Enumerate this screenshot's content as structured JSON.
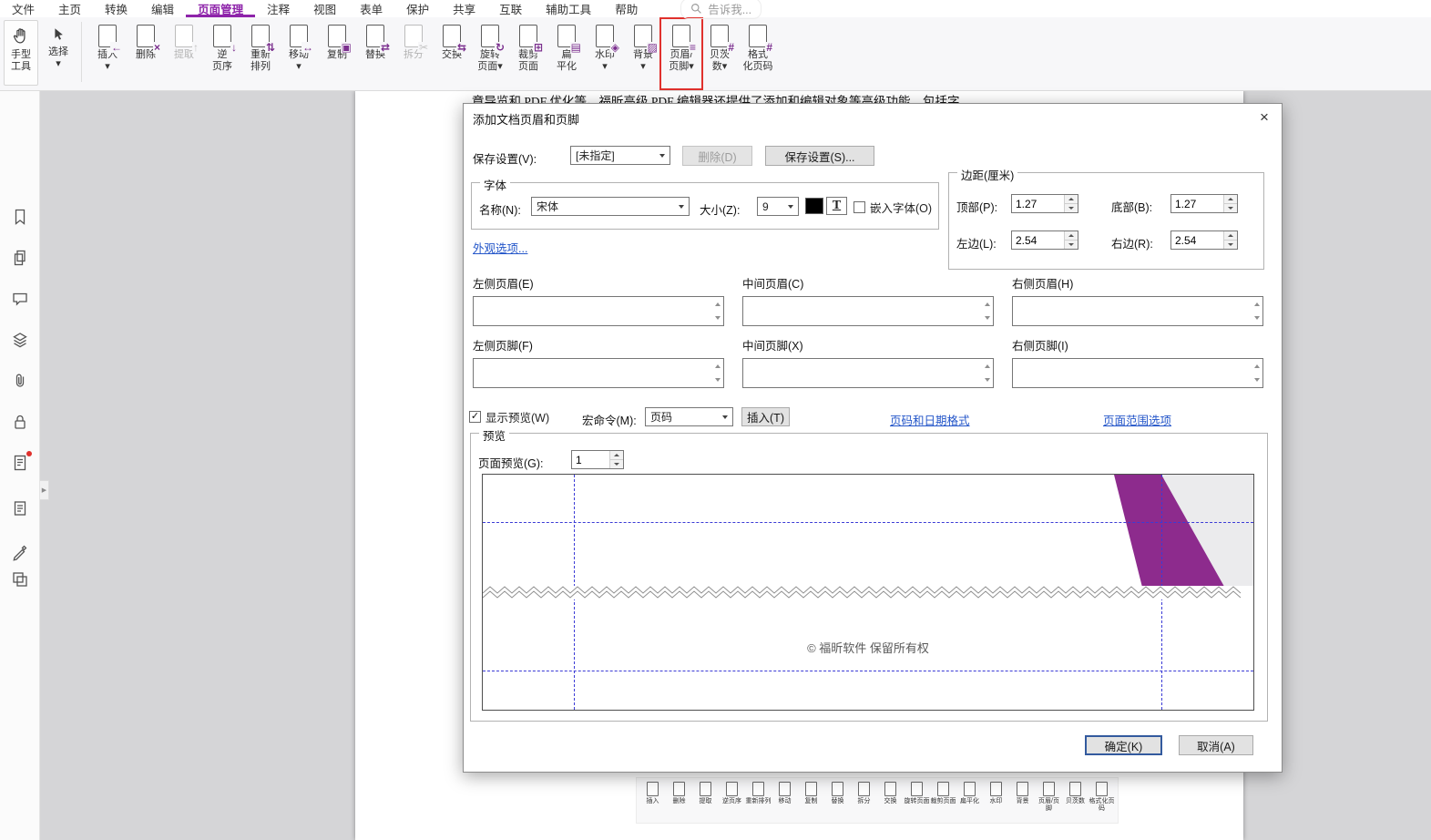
{
  "menubar": {
    "items": [
      {
        "name": "tab-file",
        "label": "文件"
      },
      {
        "name": "tab-home",
        "label": "主页"
      },
      {
        "name": "tab-convert",
        "label": "转换"
      },
      {
        "name": "tab-edit",
        "label": "编辑"
      },
      {
        "name": "tab-organize",
        "label": "页面管理",
        "class": "active"
      },
      {
        "name": "tab-comment",
        "label": "注释"
      },
      {
        "name": "tab-view",
        "label": "视图"
      },
      {
        "name": "tab-form",
        "label": "表单"
      },
      {
        "name": "tab-protect",
        "label": "保护"
      },
      {
        "name": "tab-share",
        "label": "共享"
      },
      {
        "name": "tab-connect",
        "label": "互联"
      },
      {
        "name": "tab-accessibility",
        "label": "辅助工具"
      },
      {
        "name": "tab-help",
        "label": "帮助"
      }
    ],
    "search_text": "告诉我..."
  },
  "ribbon": {
    "hand_tool_label": "手型\n工具",
    "select_label": "选择\n▾",
    "buttons": [
      {
        "name": "insert-pages-button",
        "label": "插入\n▾",
        "glyph": "←"
      },
      {
        "name": "delete-pages-button",
        "label": "删除",
        "glyph": "×"
      },
      {
        "name": "extract-pages-button",
        "label": "提取",
        "glyph": "↑",
        "class": "disabled"
      },
      {
        "name": "reverse-order-button",
        "label": "逆\n页序",
        "glyph": "↓"
      },
      {
        "name": "rearrange-pages-button",
        "label": "重新\n排列",
        "glyph": "⇅"
      },
      {
        "name": "move-pages-button",
        "label": "移动\n▾",
        "glyph": "↔"
      },
      {
        "name": "duplicate-pages-button",
        "label": "复制",
        "glyph": "▣"
      },
      {
        "name": "replace-pages-button",
        "label": "替换",
        "glyph": "⇄"
      },
      {
        "name": "split-button",
        "label": "拆分",
        "glyph": "✂",
        "class": "disabled"
      },
      {
        "name": "swap-pages-button",
        "label": "交换",
        "glyph": "⇆"
      },
      {
        "name": "rotate-pages-button",
        "label": "旋转\n页面▾",
        "glyph": "↻"
      },
      {
        "name": "crop-pages-button",
        "label": "裁剪\n页面",
        "glyph": "⊞"
      },
      {
        "name": "flatten-button",
        "label": "扁\n平化",
        "glyph": "▤"
      },
      {
        "name": "watermark-button",
        "label": "水印\n▾",
        "glyph": "◈"
      },
      {
        "name": "background-button",
        "label": "背景\n▾",
        "glyph": "▨"
      },
      {
        "name": "header-footer-button",
        "label": "页眉/\n页脚▾",
        "glyph": "≡",
        "class": "boxed"
      },
      {
        "name": "bates-numbering-button",
        "label": "贝茨\n数▾",
        "glyph": "#"
      },
      {
        "name": "format-page-numbers-button",
        "label": "格式\n化页码",
        "glyph": "#"
      }
    ]
  },
  "sidebar": {
    "icons": [
      "bookmarks",
      "page-thumbnails",
      "comments",
      "layers",
      "attachments",
      "security",
      "digital-signatures",
      "fields",
      "sign",
      "content"
    ]
  },
  "document": {
    "visible_text": "章导览和 PDF 优化等。福昕高级 PDF 编辑器还提供了添加和编辑对象等高级功能，包括字",
    "mini_toolbar": [
      "插入",
      "删除",
      "提取",
      "逆页序",
      "重新排列",
      "移动",
      "复制",
      "替换",
      "拆分",
      "交换",
      "旋转页面",
      "裁剪页面",
      "扁平化",
      "水印",
      "背景",
      "页眉/页脚",
      "贝茨数",
      "格式化页码"
    ]
  },
  "dialog": {
    "title": "添加文档页眉和页脚",
    "close_glyph": "×",
    "save_settings_label": "保存设置(V):",
    "save_settings_value": "[未指定]",
    "delete_button": "删除(D)",
    "save_button": "保存设置(S)...",
    "font_group": {
      "legend": "字体",
      "name_label": "名称(N):",
      "name_value": "宋体",
      "size_label": "大小(Z):",
      "size_value": "9",
      "style_button": "T",
      "embed_checkbox_label": "嵌入字体(O)"
    },
    "appearance_link": "外观选项...",
    "margins_group": {
      "legend": "边距(厘米)",
      "top_label": "顶部(P):",
      "top_value": "1.27",
      "bottom_label": "底部(B):",
      "bottom_value": "1.27",
      "left_label": "左边(L):",
      "left_value": "2.54",
      "right_label": "右边(R):",
      "right_value": "2.54"
    },
    "header_sections": [
      {
        "name": "left-header-section",
        "label": "左侧页眉(E)",
        "value": ""
      },
      {
        "name": "center-header-section",
        "label": "中间页眉(C)",
        "value": ""
      },
      {
        "name": "right-header-section",
        "label": "右侧页眉(H)",
        "value": ""
      }
    ],
    "footer_sections": [
      {
        "name": "left-footer-section",
        "label": "左侧页脚(F)",
        "value": ""
      },
      {
        "name": "center-footer-section",
        "label": "中间页脚(X)",
        "value": ""
      },
      {
        "name": "right-footer-section",
        "label": "右侧页脚(I)",
        "value": ""
      }
    ],
    "show_preview_label": "显示预览(W)",
    "show_preview_checked": "✓",
    "macro_label": "宏命令(M):",
    "macro_value": "页码",
    "insert_button": "插入(T)",
    "number_format_link": "页码和日期格式",
    "page_range_link": "页面范围选项",
    "preview_group": {
      "legend": "预览",
      "page_preview_label": "页面预览(G):",
      "page_preview_value": "1",
      "watermark_text": "© 福昕软件 保留所有权"
    },
    "ok_button": "确定(K)",
    "cancel_button": "取消(A)"
  },
  "colors": {
    "accent_purple": "#8e24aa",
    "highlight_red": "#e0312d",
    "margin_line_blue": "#3b3bd6",
    "corner_purple": "#8d2b8d",
    "link_blue": "#2456c9"
  }
}
